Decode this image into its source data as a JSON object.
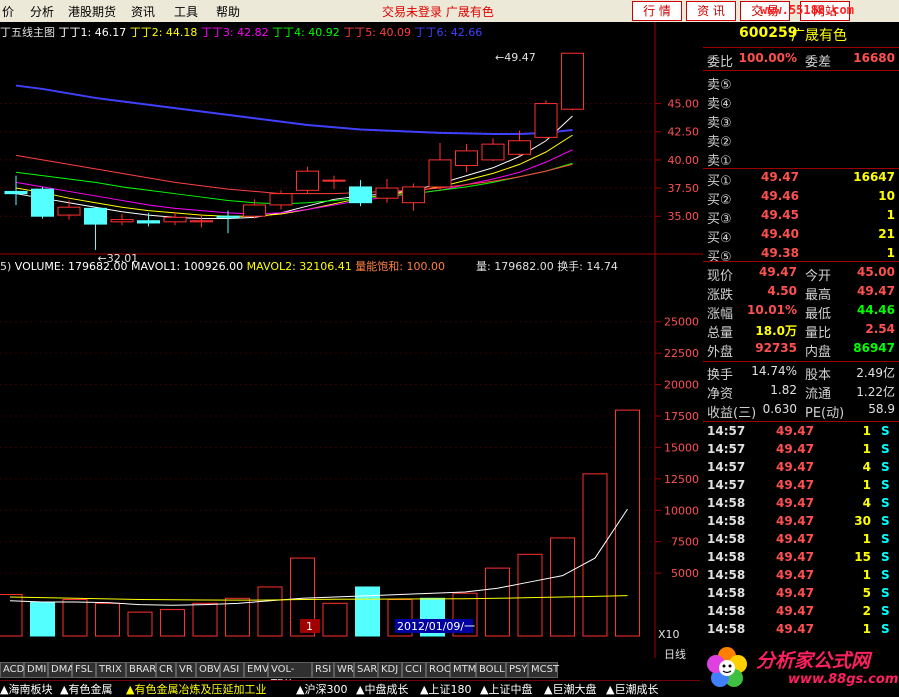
{
  "menubar": {
    "items": [
      "价",
      "分析",
      "港股期货",
      "资讯",
      "工具",
      "帮助"
    ],
    "status": "交易未登录 广晟有色",
    "buttons": [
      "行 情",
      "资 讯",
      "交 易"
    ],
    "site_badge": "网站",
    "logo_url": "www.55188.com"
  },
  "legend_main": {
    "title": "丁五线主图",
    "ma": [
      {
        "label": "丁丁1: 46.17",
        "color": "#ffffff"
      },
      {
        "label": "丁丁2: 44.18",
        "color": "#ffff00"
      },
      {
        "label": "丁丁3: 42.82",
        "color": "#ff00ff"
      },
      {
        "label": "丁丁4: 40.92",
        "color": "#00ff00"
      },
      {
        "label": "丁丁5: 40.09",
        "color": "#ff4040"
      },
      {
        "label": "丁丁6: 42.66",
        "color": "#4040ff"
      }
    ]
  },
  "legend_vol": {
    "prefix": "5)",
    "volume": "VOLUME: 179682.00",
    "mavol1": "MAVOL1: 100926.00",
    "mavol2": "MAVOL2: 32106.41",
    "saturation": "量能饱和: 100.00",
    "liang": "量: 179682.00",
    "turnover": "换手: 14.74"
  },
  "chart_data": [
    {
      "type": "candlestick",
      "title": "丁五线主图",
      "ylim": [
        32,
        51
      ],
      "y_ticks": [
        35.0,
        37.5,
        40.0,
        42.5,
        45.0
      ],
      "y_tick_labels": [
        "35.00",
        "37.50",
        "40.00",
        "42.50",
        "45.00"
      ],
      "annotations": [
        {
          "text": "←32.01",
          "x": 3,
          "y": 32.01
        },
        {
          "text": "←49.47",
          "x": 18,
          "y": 49.47
        }
      ],
      "candles": [
        {
          "open": 37.2,
          "close": 37.0,
          "high": 38.6,
          "low": 36.0
        },
        {
          "open": 37.4,
          "close": 35.0,
          "high": 37.6,
          "low": 34.8
        },
        {
          "open": 35.1,
          "close": 35.8,
          "high": 36.4,
          "low": 34.7
        },
        {
          "open": 35.7,
          "close": 34.3,
          "high": 35.8,
          "low": 32.01
        },
        {
          "open": 34.5,
          "close": 34.7,
          "high": 35.2,
          "low": 34.2
        },
        {
          "open": 34.6,
          "close": 34.4,
          "high": 35.3,
          "low": 34.1
        },
        {
          "open": 34.5,
          "close": 34.9,
          "high": 35.4,
          "low": 34.2
        },
        {
          "open": 34.5,
          "close": 34.6,
          "high": 35.2,
          "low": 34.0
        },
        {
          "open": 35.0,
          "close": 34.9,
          "high": 35.5,
          "low": 33.5
        },
        {
          "open": 35.0,
          "close": 36.0,
          "high": 36.5,
          "low": 34.8
        },
        {
          "open": 36.0,
          "close": 37.0,
          "high": 37.3,
          "low": 35.6
        },
        {
          "open": 37.3,
          "close": 39.0,
          "high": 39.4,
          "low": 37.0
        },
        {
          "open": 38.2,
          "close": 38.2,
          "high": 38.6,
          "low": 37.4
        },
        {
          "open": 37.6,
          "close": 36.2,
          "high": 38.2,
          "low": 35.9
        },
        {
          "open": 36.6,
          "close": 37.5,
          "high": 38.3,
          "low": 36.2
        },
        {
          "open": 36.2,
          "close": 37.6,
          "high": 37.9,
          "low": 35.5
        },
        {
          "open": 37.6,
          "close": 40.0,
          "high": 41.5,
          "low": 37.3
        },
        {
          "open": 39.5,
          "close": 40.8,
          "high": 41.4,
          "low": 38.9
        },
        {
          "open": 40.0,
          "close": 41.4,
          "high": 41.9,
          "low": 39.9
        },
        {
          "open": 40.5,
          "close": 41.7,
          "high": 42.6,
          "low": 40.3
        },
        {
          "open": 42.0,
          "close": 45.0,
          "high": 45.3,
          "low": 41.9
        },
        {
          "open": 44.5,
          "close": 49.47,
          "high": 49.47,
          "low": 44.4
        }
      ],
      "ma_series": [
        {
          "name": "丁丁1",
          "color": "#ffffff",
          "values": [
            37.0,
            36.6,
            36.2,
            35.8,
            35.4,
            35.1,
            34.9,
            34.8,
            34.8,
            34.9,
            35.3,
            35.9,
            36.5,
            36.8,
            37.0,
            37.3,
            37.9,
            38.6,
            39.3,
            40.3,
            41.7,
            43.9
          ]
        },
        {
          "name": "丁丁2",
          "color": "#ffff00",
          "values": [
            37.5,
            37.1,
            36.6,
            36.2,
            35.8,
            35.5,
            35.3,
            35.1,
            35.0,
            35.0,
            35.2,
            35.6,
            36.1,
            36.6,
            36.9,
            37.2,
            37.6,
            38.2,
            38.8,
            39.6,
            40.7,
            42.2
          ]
        },
        {
          "name": "丁丁3",
          "color": "#ff00ff",
          "values": [
            38.0,
            37.6,
            37.2,
            36.8,
            36.4,
            36.0,
            35.7,
            35.5,
            35.3,
            35.2,
            35.3,
            35.6,
            36.0,
            36.4,
            36.7,
            37.0,
            37.3,
            37.8,
            38.3,
            38.9,
            39.8,
            40.9
          ]
        },
        {
          "name": "丁丁4",
          "color": "#00ff00",
          "values": [
            38.9,
            38.6,
            38.3,
            38.0,
            37.6,
            37.3,
            37.0,
            36.7,
            36.4,
            36.2,
            36.1,
            36.2,
            36.4,
            36.6,
            36.8,
            37.0,
            37.3,
            37.6,
            38.0,
            38.5,
            39.0,
            39.7
          ]
        },
        {
          "name": "丁丁5",
          "color": "#ff4040",
          "values": [
            40.4,
            40.0,
            39.6,
            39.2,
            38.8,
            38.4,
            38.0,
            37.7,
            37.4,
            37.2,
            37.0,
            37.0,
            37.0,
            37.1,
            37.2,
            37.3,
            37.5,
            37.8,
            38.1,
            38.5,
            39.0,
            39.6
          ]
        },
        {
          "name": "丁丁6",
          "color": "#4040ff",
          "values": [
            46.6,
            46.3,
            45.9,
            45.5,
            45.2,
            44.9,
            44.6,
            44.3,
            44.0,
            43.7,
            43.4,
            43.1,
            42.9,
            42.7,
            42.6,
            42.5,
            42.4,
            42.35,
            42.3,
            42.3,
            42.4,
            42.66
          ]
        }
      ]
    },
    {
      "type": "bar",
      "title": "VOLUME",
      "ylim": [
        0,
        28000
      ],
      "y_ticks": [
        5000,
        7500,
        10000,
        12500,
        15000,
        17500,
        20000,
        22500,
        25000
      ],
      "y_tick_labels": [
        "5000",
        "7500",
        "10000",
        "12500",
        "15000",
        "17500",
        "20000",
        "22500",
        "25000"
      ],
      "unit_label": "X10",
      "values": [
        3300,
        2700,
        2900,
        2600,
        1900,
        2100,
        2600,
        3000,
        3900,
        6200,
        2600,
        3900,
        2900,
        3000,
        3400,
        5400,
        6500,
        7800,
        12900,
        17968
      ],
      "colors": [
        "up",
        "down",
        "up",
        "up",
        "up",
        "up",
        "up",
        "up",
        "up",
        "up",
        "up",
        "down",
        "up",
        "down",
        "up",
        "up",
        "up",
        "up",
        "up",
        "up"
      ],
      "mavol1": [
        2800,
        2700,
        2700,
        2650,
        2500,
        2450,
        2500,
        2600,
        2800,
        3000,
        3100,
        3200,
        3300,
        3400,
        3500,
        3800,
        4300,
        4800,
        6200,
        10092
      ],
      "mavol2": [
        3100,
        3050,
        3000,
        2950,
        2900,
        2880,
        2860,
        2850,
        2860,
        2900,
        2920,
        2930,
        2940,
        2950,
        2960,
        3000,
        3050,
        3100,
        3150,
        3210
      ],
      "date_label": "2012/01/09/一",
      "marker_label": "1"
    }
  ],
  "quote": {
    "code": "600259",
    "name": "广晟有色",
    "weibi_label": "委比",
    "weibi": "100.00%",
    "weicha_label": "委差",
    "weicha": "16680",
    "sell": [
      {
        "label": "卖⑤",
        "price": "",
        "vol": ""
      },
      {
        "label": "卖④",
        "price": "",
        "vol": ""
      },
      {
        "label": "卖③",
        "price": "",
        "vol": ""
      },
      {
        "label": "卖②",
        "price": "",
        "vol": ""
      },
      {
        "label": "卖①",
        "price": "",
        "vol": ""
      }
    ],
    "buy": [
      {
        "label": "买①",
        "price": "49.47",
        "vol": "16647"
      },
      {
        "label": "买②",
        "price": "49.46",
        "vol": "10"
      },
      {
        "label": "买③",
        "price": "49.45",
        "vol": "1"
      },
      {
        "label": "买④",
        "price": "49.40",
        "vol": "21"
      },
      {
        "label": "买⑤",
        "price": "49.38",
        "vol": "1"
      }
    ],
    "stats": [
      {
        "l1": "现价",
        "v1": "49.47",
        "l2": "今开",
        "v2": "45.00",
        "c1": "#ff5050",
        "c2": "#ff5050"
      },
      {
        "l1": "涨跌",
        "v1": "4.50",
        "l2": "最高",
        "v2": "49.47",
        "c1": "#ff5050",
        "c2": "#ff5050"
      },
      {
        "l1": "涨幅",
        "v1": "10.01%",
        "l2": "最低",
        "v2": "44.46",
        "c1": "#ff5050",
        "c2": "#00ff00"
      },
      {
        "l1": "总量",
        "v1": "18.0万",
        "l2": "量比",
        "v2": "2.54",
        "c1": "#ffff00",
        "c2": "#ff5050"
      },
      {
        "l1": "外盘",
        "v1": "92735",
        "l2": "内盘",
        "v2": "86947",
        "c1": "#ff5050",
        "c2": "#00ff00"
      }
    ],
    "stats2": [
      {
        "l1": "换手",
        "v1": "14.74%",
        "l2": "股本",
        "v2": "2.49亿",
        "c1": "#e0e0e0",
        "c2": "#e0e0e0"
      },
      {
        "l1": "净资",
        "v1": "1.82",
        "l2": "流通",
        "v2": "1.22亿",
        "c1": "#e0e0e0",
        "c2": "#e0e0e0"
      },
      {
        "l1": "收益(三)",
        "v1": "0.630",
        "l2": "PE(动)",
        "v2": "58.9",
        "c1": "#e0e0e0",
        "c2": "#e0e0e0"
      }
    ],
    "ticks": [
      {
        "time": "14:57",
        "price": "49.47",
        "vol": "1",
        "side": "S"
      },
      {
        "time": "14:57",
        "price": "49.47",
        "vol": "1",
        "side": "S"
      },
      {
        "time": "14:57",
        "price": "49.47",
        "vol": "4",
        "side": "S"
      },
      {
        "time": "14:57",
        "price": "49.47",
        "vol": "1",
        "side": "S"
      },
      {
        "time": "14:58",
        "price": "49.47",
        "vol": "4",
        "side": "S"
      },
      {
        "time": "14:58",
        "price": "49.47",
        "vol": "30",
        "side": "S"
      },
      {
        "time": "14:58",
        "price": "49.47",
        "vol": "1",
        "side": "S"
      },
      {
        "time": "14:58",
        "price": "49.47",
        "vol": "15",
        "side": "S"
      },
      {
        "time": "14:58",
        "price": "49.47",
        "vol": "1",
        "side": "S"
      },
      {
        "time": "14:58",
        "price": "49.47",
        "vol": "5",
        "side": "S"
      },
      {
        "time": "14:58",
        "price": "49.47",
        "vol": "2",
        "side": "S"
      },
      {
        "time": "14:58",
        "price": "49.47",
        "vol": "1",
        "side": "S"
      }
    ]
  },
  "period_label": "日线",
  "indicator_tabs": [
    "ACD",
    "DMI",
    "DMA",
    "FSL",
    "TRIX",
    "BRAR",
    "CR",
    "VR",
    "OBV",
    "ASI",
    "EMV",
    "VOL-TDX",
    "RSI",
    "WR",
    "SAR",
    "KDJ",
    "CCI",
    "ROC",
    "MTM",
    "BOLL",
    "PSY",
    "MCST"
  ],
  "sector_tabs": [
    "海南板块",
    "有色金属",
    "有色金属冶炼及压延加工业",
    "沪深300",
    "中盘成长",
    "上证180",
    "上证中盘",
    "巨潮大盘",
    "巨潮成长"
  ],
  "ad_logo": {
    "name": "分析家公式网",
    "url": "www.88gs.com"
  }
}
